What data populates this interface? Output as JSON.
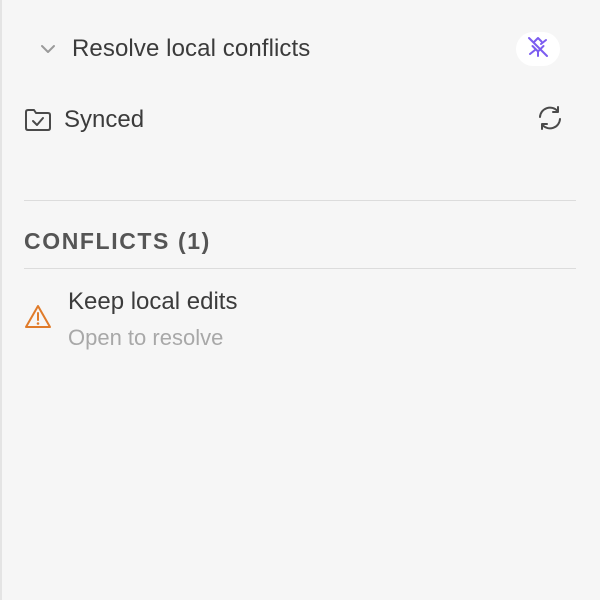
{
  "header": {
    "title": "Resolve local conflicts",
    "collapse_icon": "chevron-down-icon",
    "plugin_icon": "plugin-icon",
    "plugin_accent": "#7b5cf0"
  },
  "sync": {
    "status_label": "Synced",
    "status_icon": "folder-check-icon",
    "refresh_icon": "refresh-icon"
  },
  "conflicts": {
    "section_title": "CONFLICTS (1)",
    "items": [
      {
        "title": "Keep local edits",
        "subtitle": "Open to resolve",
        "icon": "warning-icon",
        "icon_color": "#e07b2a"
      }
    ]
  },
  "colors": {
    "background": "#f6f6f6",
    "text": "#3b3b3b",
    "muted_text": "#a8a8a8",
    "section_text": "#555555",
    "divider": "#dcdcdc"
  }
}
